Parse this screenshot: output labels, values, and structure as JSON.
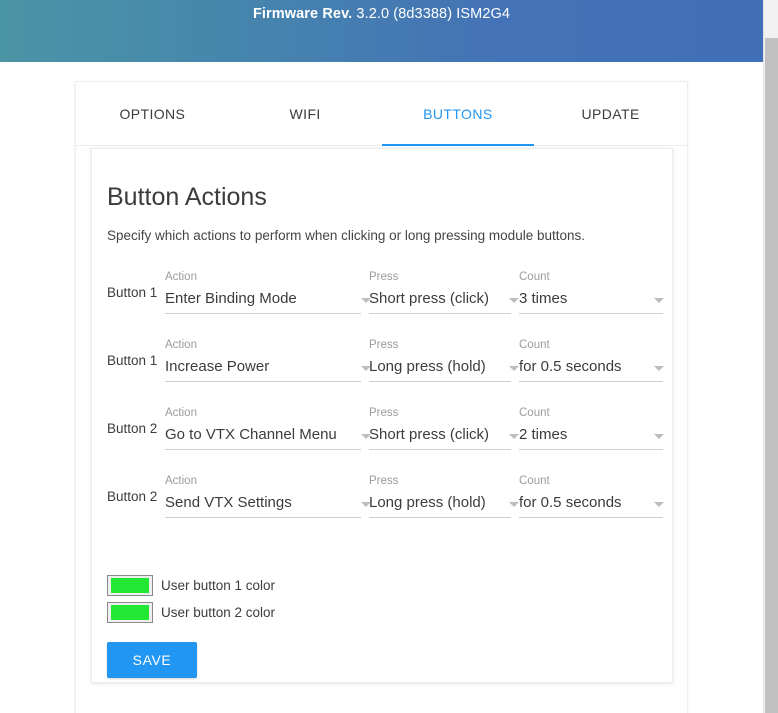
{
  "header": {
    "title_bold": "Firmware Rev.",
    "title_rest": " 3.2.0 (8d3388) ISM2G4",
    "gradient_start": "#4a95a6",
    "gradient_end": "#4270b8"
  },
  "tabs": [
    {
      "label": "OPTIONS",
      "active": false
    },
    {
      "label": "WIFI",
      "active": false
    },
    {
      "label": "BUTTONS",
      "active": true
    },
    {
      "label": "UPDATE",
      "active": false
    }
  ],
  "accent_color": "#2196f3",
  "section": {
    "title": "Button Actions",
    "description": "Specify which actions to perform when clicking or long pressing module buttons."
  },
  "field_labels": {
    "action": "Action",
    "press": "Press",
    "count": "Count"
  },
  "rows": [
    {
      "button": "Button 1",
      "action": "Enter Binding Mode",
      "press": "Short press (click)",
      "count": "3 times"
    },
    {
      "button": "Button 1",
      "action": "Increase Power",
      "press": "Long press (hold)",
      "count": "for 0.5 seconds"
    },
    {
      "button": "Button 2",
      "action": "Go to VTX Channel Menu",
      "press": "Short press (click)",
      "count": "2 times"
    },
    {
      "button": "Button 2",
      "action": "Send VTX Settings",
      "press": "Long press (hold)",
      "count": "for 0.5 seconds"
    }
  ],
  "colors": [
    {
      "label": "User button 1 color",
      "value": "#22e833"
    },
    {
      "label": "User button 2 color",
      "value": "#22e833"
    }
  ],
  "save": {
    "label": "SAVE"
  }
}
